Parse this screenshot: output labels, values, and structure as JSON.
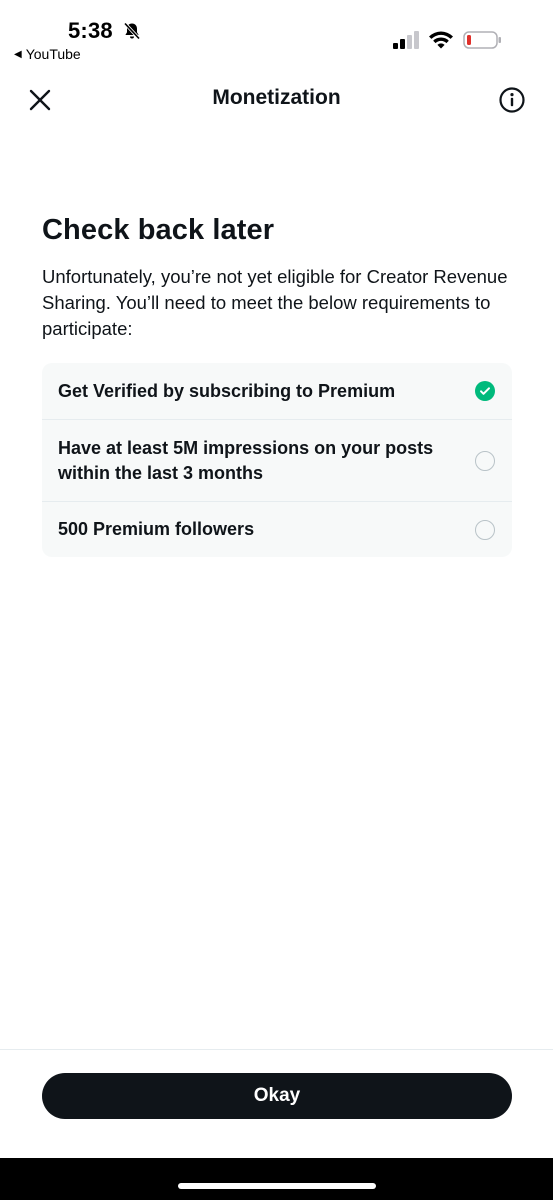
{
  "status_bar": {
    "time": "5:38",
    "back_app": "YouTube",
    "icons": [
      "bell-slash-icon",
      "cellular-signal-icon",
      "wifi-icon",
      "battery-low-icon"
    ],
    "battery_color": "#e0302a"
  },
  "header": {
    "title": "Monetization",
    "close_icon": "close-icon",
    "info_icon": "info-icon"
  },
  "main": {
    "heading": "Check back later",
    "description": "Unfortunately, you’re not yet eligible for Creator Revenue Sharing. You’ll need to meet the below requirements to participate:",
    "requirements": [
      {
        "label": "Get Verified by subscribing to Premium",
        "met": true
      },
      {
        "label": "Have at least 5M impressions on your posts within the last 3 months",
        "met": false
      },
      {
        "label": "500 Premium followers",
        "met": false
      }
    ]
  },
  "footer": {
    "okay_label": "Okay"
  },
  "colors": {
    "text_primary": "#0f1419",
    "check_green": "#00ba7c",
    "card_bg": "#f7f9f9",
    "button_bg": "#0f1419"
  }
}
